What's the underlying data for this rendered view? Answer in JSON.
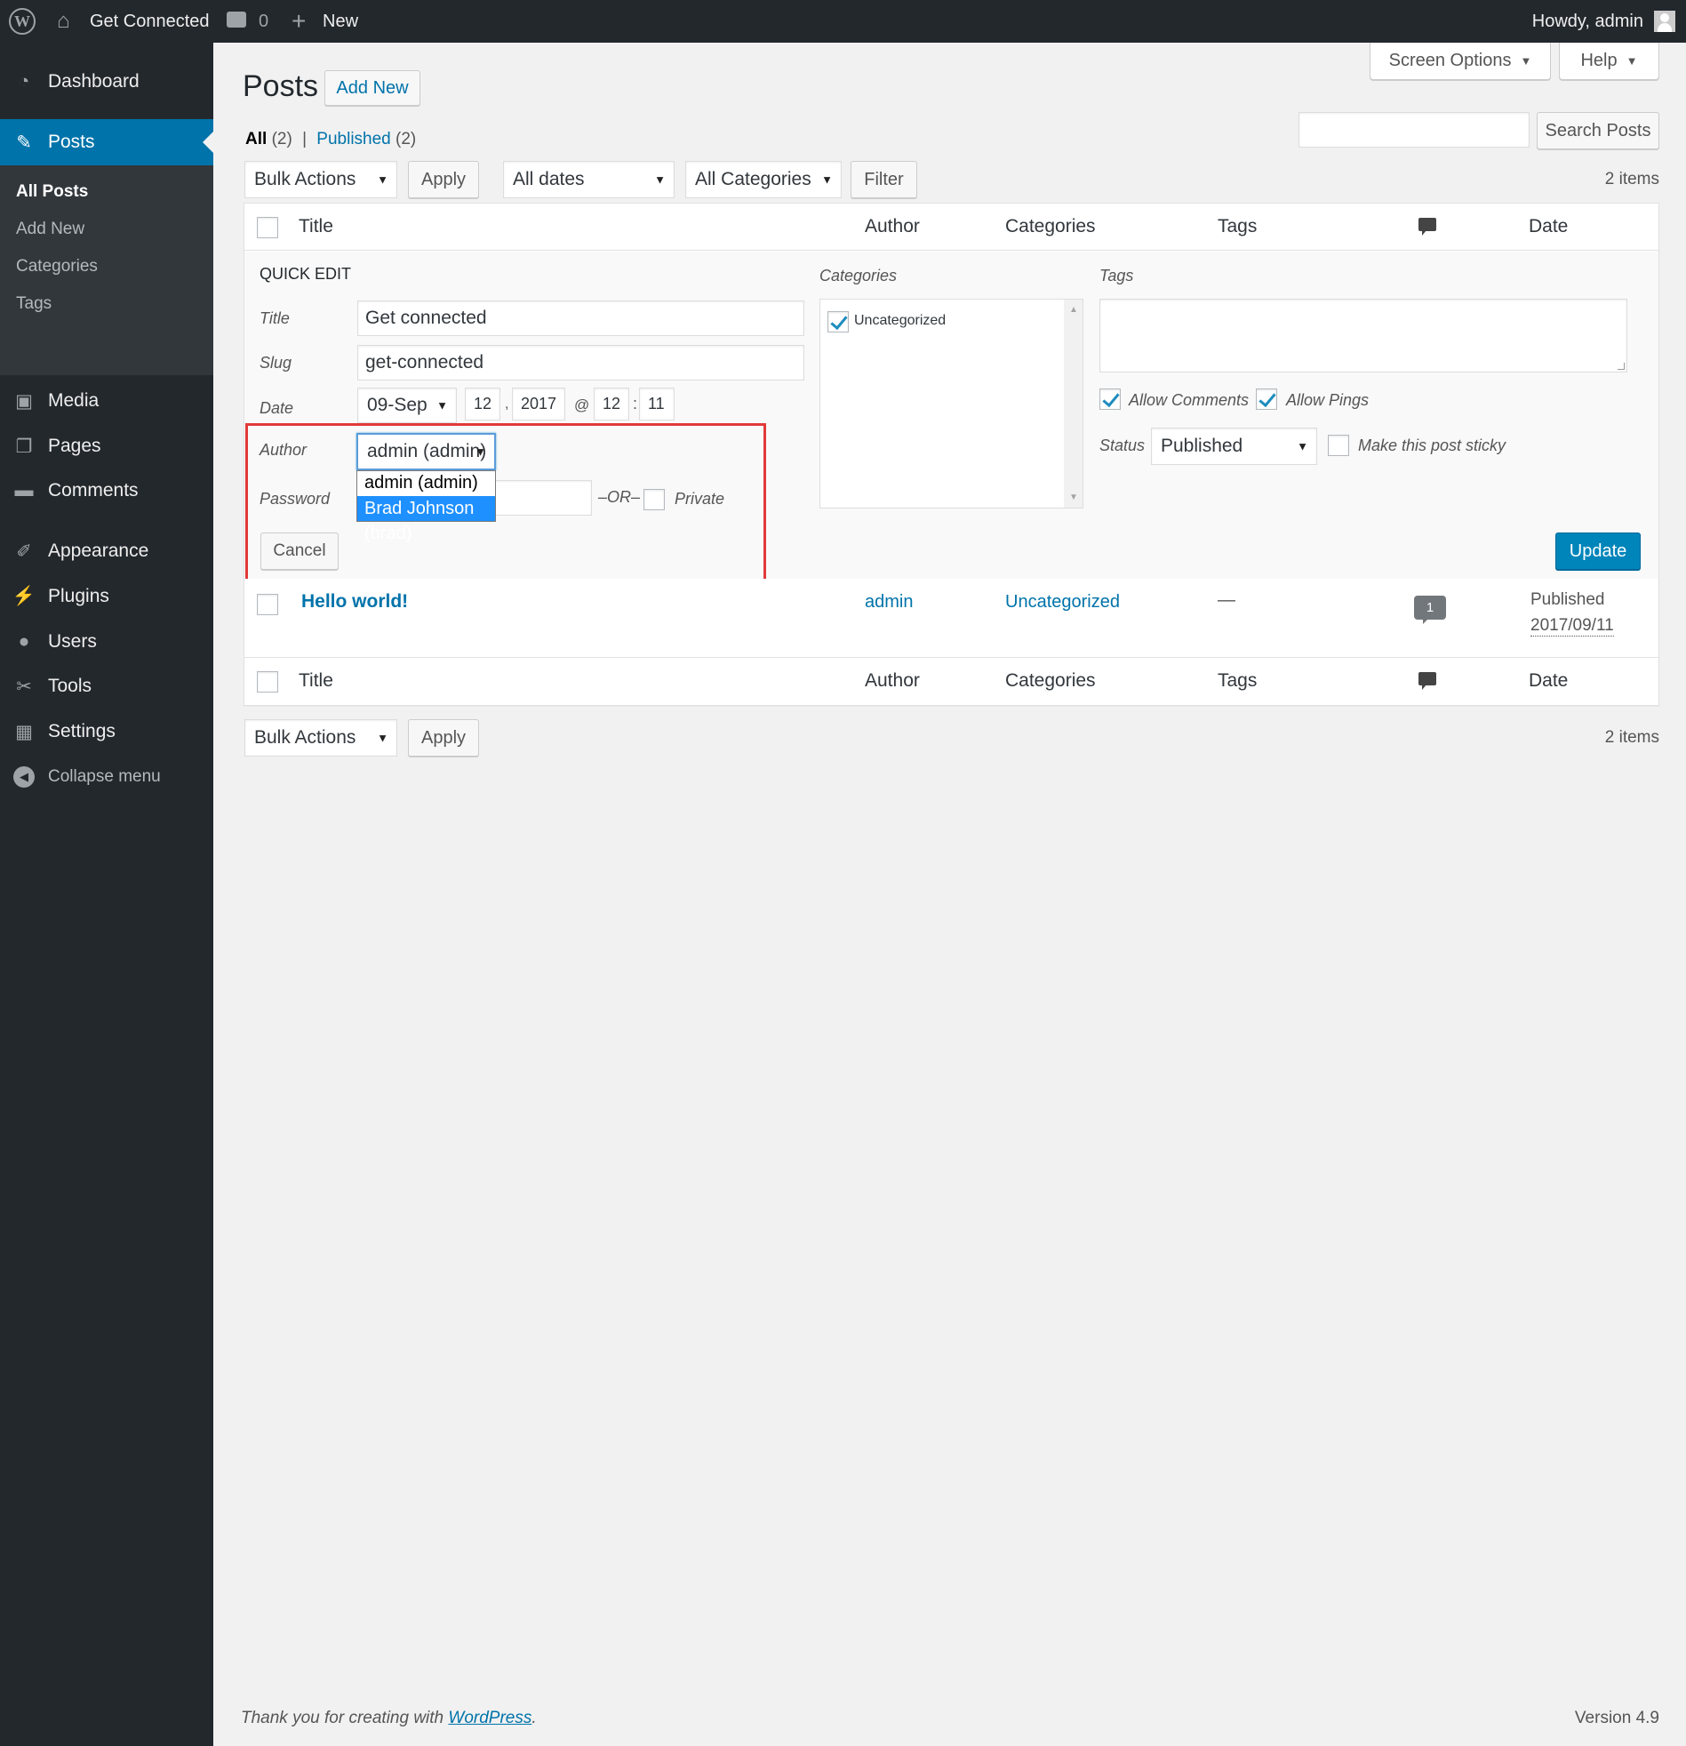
{
  "admin_bar": {
    "site_name": "Get Connected",
    "comments_count": "0",
    "new_label": "New",
    "howdy": "Howdy, admin"
  },
  "sidebar": {
    "items": [
      {
        "label": "Dashboard",
        "icon": "dashboard-icon"
      },
      {
        "label": "Posts",
        "icon": "pushpin-icon",
        "active": true
      },
      {
        "label": "Media",
        "icon": "media-icon"
      },
      {
        "label": "Pages",
        "icon": "pages-icon"
      },
      {
        "label": "Comments",
        "icon": "comment-icon"
      },
      {
        "label": "Appearance",
        "icon": "paintbrush-icon"
      },
      {
        "label": "Plugins",
        "icon": "plugin-icon"
      },
      {
        "label": "Users",
        "icon": "users-icon"
      },
      {
        "label": "Tools",
        "icon": "wrench-icon"
      },
      {
        "label": "Settings",
        "icon": "settings-icon"
      }
    ],
    "posts_submenu": [
      "All Posts",
      "Add New",
      "Categories",
      "Tags"
    ],
    "collapse": "Collapse menu"
  },
  "screen_options": "Screen Options",
  "help": "Help",
  "page_title": "Posts",
  "add_new": "Add New",
  "views": {
    "all": "All",
    "all_count": "(2)",
    "sep": "|",
    "published": "Published",
    "published_count": "(2)"
  },
  "search_button": "Search Posts",
  "search_value": "",
  "filters": {
    "bulk_actions": "Bulk Actions",
    "apply": "Apply",
    "dates": "All dates",
    "categories": "All Categories",
    "filter": "Filter",
    "items_count": "2 items"
  },
  "columns": {
    "title": "Title",
    "author": "Author",
    "categories": "Categories",
    "tags": "Tags",
    "date": "Date"
  },
  "quick_edit": {
    "heading": "QUICK EDIT",
    "title_label": "Title",
    "title_value": "Get connected",
    "slug_label": "Slug",
    "slug_value": "get-connected",
    "date_label": "Date",
    "month": "09-Sep",
    "day": "12",
    "sep_comma": ",",
    "year": "2017",
    "at": "@",
    "hour": "12",
    "colon": ":",
    "minute": "11",
    "author_label": "Author",
    "author_value": "admin (admin)",
    "author_options": [
      "admin (admin)",
      "Brad Johnson (brad)"
    ],
    "password_label": "Password",
    "or": "–OR–",
    "private": "Private",
    "cancel": "Cancel",
    "categories_label": "Categories",
    "category_item": "Uncategorized",
    "tags_label": "Tags",
    "allow_comments": "Allow Comments",
    "allow_pings": "Allow Pings",
    "status_label": "Status",
    "status_value": "Published",
    "sticky": "Make this post sticky",
    "update": "Update"
  },
  "post_row": {
    "title": "Hello world!",
    "author": "admin",
    "category": "Uncategorized",
    "tags": "—",
    "comments": "1",
    "status": "Published",
    "date": "2017/09/11"
  },
  "footer": {
    "thanks": "Thank you for creating with ",
    "wordpress": "WordPress",
    "period": ".",
    "version": "Version 4.9"
  },
  "colors": {
    "admin_bar": "#23282d",
    "accent": "#0073aa",
    "active_menu": "#0073aa",
    "highlight": "#e23a3a",
    "dropdown_selected": "#1e90ff"
  }
}
